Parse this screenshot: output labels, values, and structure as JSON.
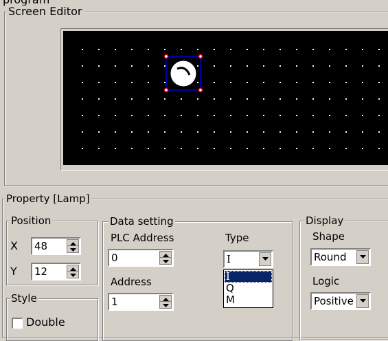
{
  "top_clip_text": "program",
  "screen_editor": {
    "title": "Screen Editor",
    "canvas_bg": "#000000",
    "selection_color": "#0000a0",
    "handle_color": "#ff0000",
    "lamp_icon": "lamp-round-icon"
  },
  "property": {
    "title": "Property  [Lamp]",
    "position": {
      "title": "Position",
      "x_label": "X",
      "x_value": "48",
      "y_label": "Y",
      "y_value": "12"
    },
    "style": {
      "title": "Style",
      "double_label": "Double",
      "double_checked": false
    },
    "data_setting": {
      "title": "Data setting",
      "plc_address_label": "PLC Address",
      "plc_address_value": "0",
      "address_label": "Address",
      "address_value": "1",
      "type_label": "Type",
      "type_value": "I",
      "type_options": [
        "I",
        "Q",
        "M"
      ],
      "type_highlighted": "I"
    },
    "display": {
      "title": "Display",
      "shape_label": "Shape",
      "shape_value": "Round",
      "logic_label": "Logic",
      "logic_value": "Positive"
    }
  }
}
